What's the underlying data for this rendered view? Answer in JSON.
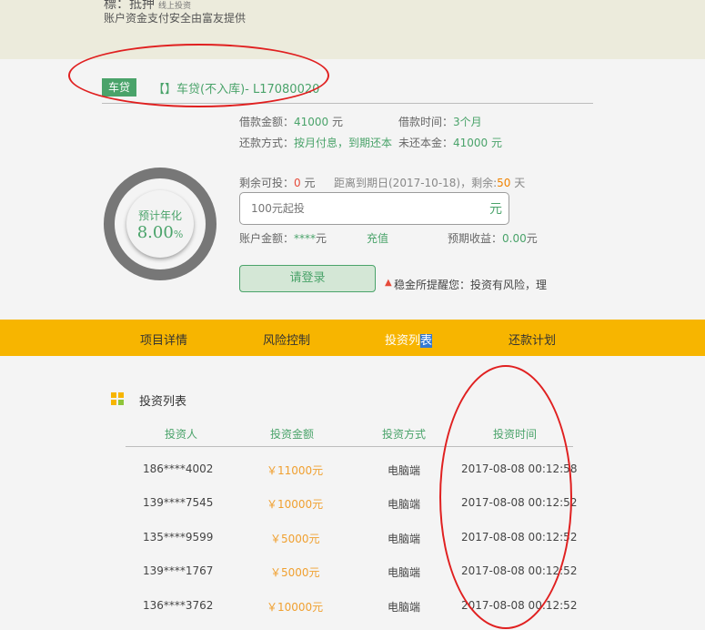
{
  "header": {
    "title": "標：抵押",
    "title_small": "线上投资",
    "subtitle": "账户资金支付安全由富友提供"
  },
  "loan": {
    "badge": "车贷",
    "title": "【】车贷(不入库)- L17080020"
  },
  "info": {
    "amount_label": "借款金额：",
    "amount_value": "41000",
    "amount_unit": " 元",
    "term_label": "借款时间：",
    "term_value": "3个月",
    "repay_label": "还款方式：",
    "repay_value": "按月付息，到期还本",
    "unpaid_label": "未还本金：",
    "unpaid_value": "41000 元",
    "remaining_label": "剩余可投：",
    "remaining_value": "0",
    "remaining_unit": " 元",
    "deadline_text": "距离到期日(2017-10-18)，剩余:",
    "deadline_days": "50",
    "deadline_unit": " 天",
    "balance_label": "账户金额：",
    "balance_value": "****",
    "balance_unit": "元",
    "recharge": "充值",
    "expected_label": "预期收益：",
    "expected_value": "0.00",
    "expected_unit": "元"
  },
  "rate": {
    "label": "预计年化",
    "value": "8.00",
    "unit": "%"
  },
  "invest_input": {
    "placeholder": "100元起投",
    "unit": "元"
  },
  "login_button": "请登录",
  "warning": {
    "icon": "warning-triangle-icon",
    "text": "稳金所提醒您：投资有风险，理"
  },
  "tabs": {
    "details": "项目详情",
    "risk": "风险控制",
    "list_part1": "投资列",
    "list_part2": "表",
    "plan": "还款计划"
  },
  "section": {
    "icon": "grid-icon",
    "title": "投资列表"
  },
  "table": {
    "headers": [
      "投资人",
      "投资金额",
      "投资方式",
      "投资时间"
    ],
    "rows": [
      [
        "186****4002",
        "￥11000元",
        "电脑端",
        "2017-08-08 00:12:58"
      ],
      [
        "139****7545",
        "￥10000元",
        "电脑端",
        "2017-08-08 00:12:52"
      ],
      [
        "135****9599",
        "￥5000元",
        "电脑端",
        "2017-08-08 00:12:52"
      ],
      [
        "139****1767",
        "￥5000元",
        "电脑端",
        "2017-08-08 00:12:52"
      ],
      [
        "136****3762",
        "￥10000元",
        "电脑端",
        "2017-08-08 00:12:52"
      ]
    ]
  },
  "colors": {
    "accent_green": "#4aa36a",
    "tab_bar": "#f7b500",
    "amount_orange": "#f0a030",
    "annotation_red": "#e02020"
  }
}
